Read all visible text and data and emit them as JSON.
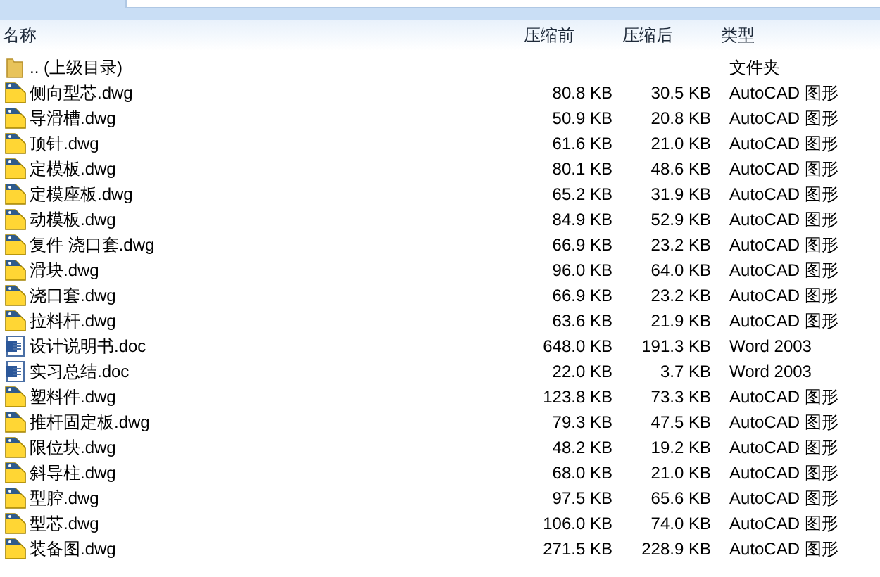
{
  "header": {
    "columns": [
      "名称",
      "压缩前",
      "压缩后",
      "类型"
    ]
  },
  "rows": [
    {
      "kind": "folder",
      "name": ".. (上级目录)",
      "size": "",
      "packed": "",
      "type": "文件夹"
    },
    {
      "kind": "dwg",
      "name": "侧向型芯.dwg",
      "size": "80.8 KB",
      "packed": "30.5 KB",
      "type": "AutoCAD 图形"
    },
    {
      "kind": "dwg",
      "name": "导滑槽.dwg",
      "size": "50.9 KB",
      "packed": "20.8 KB",
      "type": "AutoCAD 图形"
    },
    {
      "kind": "dwg",
      "name": "顶针.dwg",
      "size": "61.6 KB",
      "packed": "21.0 KB",
      "type": "AutoCAD 图形"
    },
    {
      "kind": "dwg",
      "name": "定模板.dwg",
      "size": "80.1 KB",
      "packed": "48.6 KB",
      "type": "AutoCAD 图形"
    },
    {
      "kind": "dwg",
      "name": "定模座板.dwg",
      "size": "65.2 KB",
      "packed": "31.9 KB",
      "type": "AutoCAD 图形"
    },
    {
      "kind": "dwg",
      "name": "动模板.dwg",
      "size": "84.9 KB",
      "packed": "52.9 KB",
      "type": "AutoCAD 图形"
    },
    {
      "kind": "dwg",
      "name": "复件 浇口套.dwg",
      "size": "66.9 KB",
      "packed": "23.2 KB",
      "type": "AutoCAD 图形"
    },
    {
      "kind": "dwg",
      "name": "滑块.dwg",
      "size": "96.0 KB",
      "packed": "64.0 KB",
      "type": "AutoCAD 图形"
    },
    {
      "kind": "dwg",
      "name": "浇口套.dwg",
      "size": "66.9 KB",
      "packed": "23.2 KB",
      "type": "AutoCAD 图形"
    },
    {
      "kind": "dwg",
      "name": "拉料杆.dwg",
      "size": "63.6 KB",
      "packed": "21.9 KB",
      "type": "AutoCAD 图形"
    },
    {
      "kind": "doc",
      "name": "设计说明书.doc",
      "size": "648.0 KB",
      "packed": "191.3 KB",
      "type": "Word 2003"
    },
    {
      "kind": "doc",
      "name": "实习总结.doc",
      "size": "22.0 KB",
      "packed": "3.7 KB",
      "type": "Word 2003"
    },
    {
      "kind": "dwg",
      "name": "塑料件.dwg",
      "size": "123.8 KB",
      "packed": "73.3 KB",
      "type": "AutoCAD 图形"
    },
    {
      "kind": "dwg",
      "name": "推杆固定板.dwg",
      "size": "79.3 KB",
      "packed": "47.5 KB",
      "type": "AutoCAD 图形"
    },
    {
      "kind": "dwg",
      "name": "限位块.dwg",
      "size": "48.2 KB",
      "packed": "19.2 KB",
      "type": "AutoCAD 图形"
    },
    {
      "kind": "dwg",
      "name": "斜导柱.dwg",
      "size": "68.0 KB",
      "packed": "21.0 KB",
      "type": "AutoCAD 图形"
    },
    {
      "kind": "dwg",
      "name": "型腔.dwg",
      "size": "97.5 KB",
      "packed": "65.6 KB",
      "type": "AutoCAD 图形"
    },
    {
      "kind": "dwg",
      "name": "型芯.dwg",
      "size": "106.0 KB",
      "packed": "74.0 KB",
      "type": "AutoCAD 图形"
    },
    {
      "kind": "dwg",
      "name": "装备图.dwg",
      "size": "271.5 KB",
      "packed": "228.9 KB",
      "type": "AutoCAD 图形"
    }
  ]
}
